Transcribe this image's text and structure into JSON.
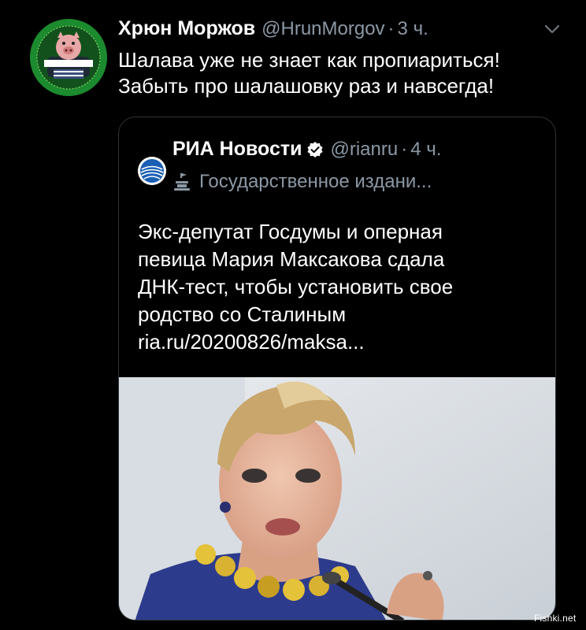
{
  "tweet": {
    "author_name": "Хрюн Моржов",
    "author_handle": "@HrunMorgov",
    "separator": "·",
    "time": "3 ч.",
    "text_lines": [
      "Шалава уже не знает как пропиариться!",
      "Забыть про шалашовку раз и навсегда!"
    ],
    "avatar_lettering": "Хрюн Моржов",
    "menu_icon": "chevron-down-icon"
  },
  "quote": {
    "author_name": "РИА Новости",
    "verified_icon": "verified-badge-icon",
    "author_handle": "@rianru",
    "separator": "·",
    "time": "4 ч.",
    "label_icon": "government-building-icon",
    "label": "Государственное издани...",
    "text_lines": [
      "Экс-депутат Госдумы и оперная",
      "певица Мария Максакова сдала",
      "ДНК-тест, чтобы установить свое",
      "родство со Сталиным",
      "ria.ru/20200826/maksa..."
    ]
  },
  "watermark": "Fishki.net",
  "colors": {
    "background": "#000000",
    "text_primary": "#ffffff",
    "text_secondary": "#8b98a5",
    "card_border": "#2f3336",
    "verified": "#ffffff",
    "ria_blue": "#1a5fb4"
  }
}
